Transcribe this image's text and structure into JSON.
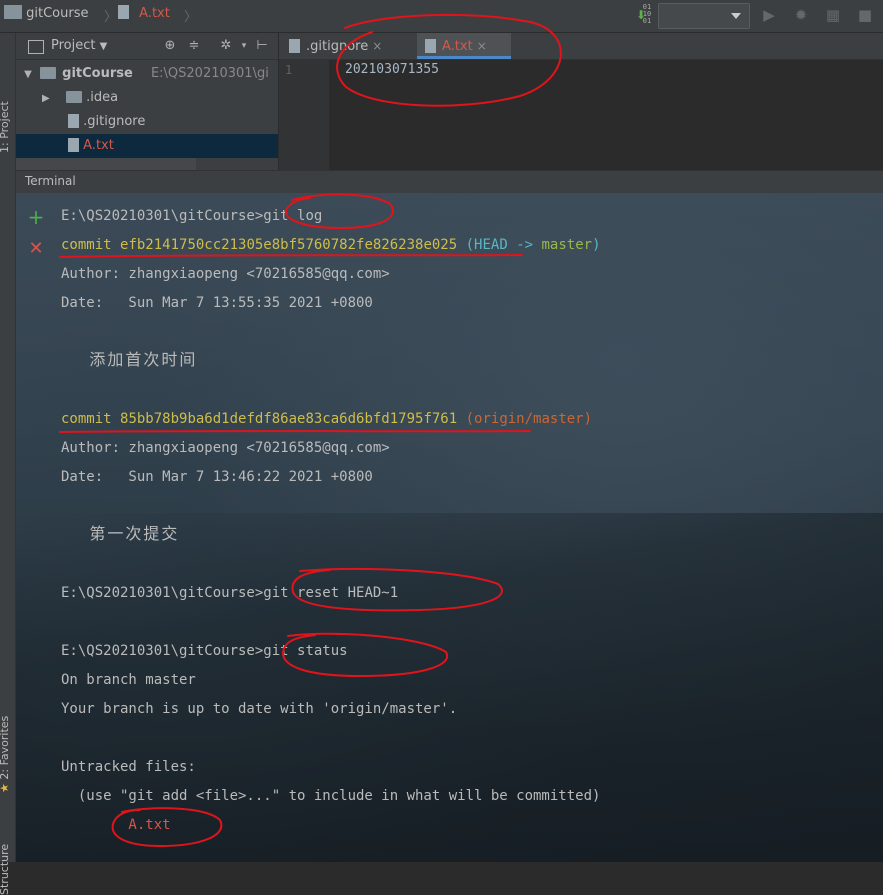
{
  "navbar": {
    "project_crumb": "gitCourse",
    "file_crumb": "A.txt"
  },
  "side_tabs": {
    "project": "1: Project",
    "favorites": "2: Favorites",
    "structure": "Structure"
  },
  "project_panel": {
    "title": "Project",
    "tree": [
      {
        "name": "gitCourse",
        "path": "E:\\QS20210301\\gi"
      },
      {
        "name": ".idea"
      },
      {
        "name": ".gitignore"
      },
      {
        "name": "A.txt"
      }
    ]
  },
  "editor": {
    "tabs": [
      {
        "label": ".gitignore",
        "close": "×"
      },
      {
        "label": "A.txt",
        "close": "×"
      }
    ],
    "line_number": "1",
    "line_text": "202103071355"
  },
  "terminal": {
    "title": "Terminal",
    "lines": [
      {
        "prompt": "E:\\QS20210301\\gitCourse>",
        "cmd": "git log"
      },
      {
        "commit_label": "commit",
        "hash": "efb2141750cc21305e8bf5760782fe826238e025",
        "ref_open": "(",
        "ref_head": "HEAD -> ",
        "ref_branch": "master",
        "ref_close": ")"
      },
      {
        "text": "Author: zhangxiaopeng <70216585@qq.com>"
      },
      {
        "text": "Date:   Sun Mar 7 13:55:35 2021 +0800"
      },
      {
        "text": "    添加首次时间"
      },
      {
        "commit_label": "commit",
        "hash": "85bb78b9ba6d1defdf86ae83ca6d6bfd1795f761",
        "ref": "(origin/master)"
      },
      {
        "text": "Author: zhangxiaopeng <70216585@qq.com>"
      },
      {
        "text": "Date:   Sun Mar 7 13:46:22 2021 +0800"
      },
      {
        "text": "    第一次提交"
      },
      {
        "prompt": "E:\\QS20210301\\gitCourse>",
        "cmd": "git reset HEAD~1"
      },
      {
        "prompt": "E:\\QS20210301\\gitCourse>",
        "cmd": "git status"
      },
      {
        "text": "On branch master"
      },
      {
        "text": "Your branch is up to date with 'origin/master'."
      },
      {
        "text": "Untracked files:"
      },
      {
        "text": "  (use \"git add <file>...\" to include in what will be committed)"
      },
      {
        "text": "        A.txt"
      }
    ]
  },
  "colors": {
    "annotation": "#e0141b",
    "commit_yellow": "#cfbd4a",
    "untracked_red": "#d4584a",
    "add_green": "#4caf50",
    "close_red": "#d9534f"
  }
}
